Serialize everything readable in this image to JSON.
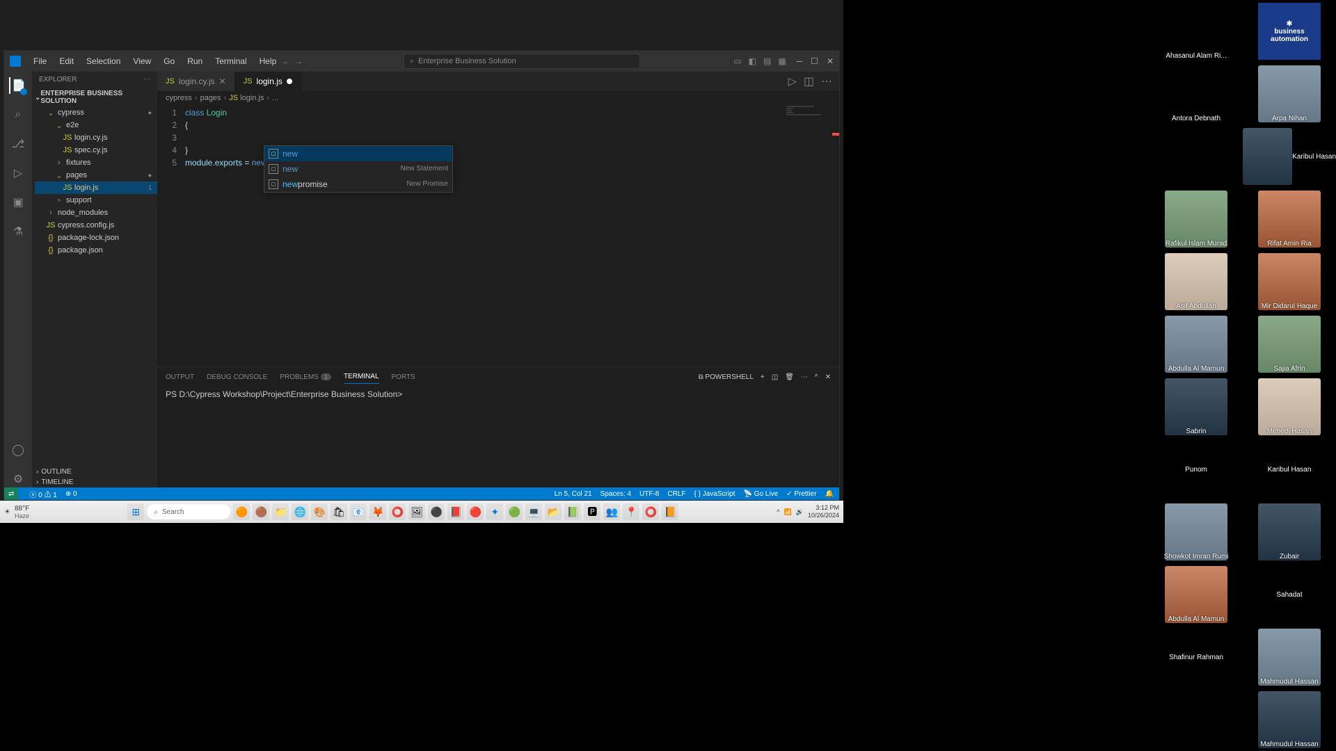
{
  "vscode": {
    "menu": [
      "File",
      "Edit",
      "Selection",
      "View",
      "Go",
      "Run",
      "Terminal",
      "Help"
    ],
    "searchPlaceholder": "Enterprise Business Solution",
    "tabs": [
      {
        "label": "login.cy.js",
        "active": false,
        "modified": false
      },
      {
        "label": "login.js",
        "active": true,
        "modified": true
      }
    ],
    "breadcrumb": [
      "cypress",
      "pages",
      "login.js",
      "..."
    ],
    "sidebar": {
      "header": "EXPLORER",
      "project": "ENTERPRISE BUSINESS SOLUTION",
      "tree": [
        {
          "label": "cypress",
          "kind": "folder",
          "ind": 1,
          "open": true,
          "badge": "●"
        },
        {
          "label": "e2e",
          "kind": "folder",
          "ind": 2,
          "open": true
        },
        {
          "label": "login.cy.js",
          "kind": "js",
          "ind": 3
        },
        {
          "label": "spec.cy.js",
          "kind": "js",
          "ind": 3
        },
        {
          "label": "fixtures",
          "kind": "folder",
          "ind": 2
        },
        {
          "label": "pages",
          "kind": "folder",
          "ind": 2,
          "open": true,
          "badge": "●"
        },
        {
          "label": "login.js",
          "kind": "js",
          "ind": 3,
          "selected": true,
          "active": true,
          "badge": "1"
        },
        {
          "label": "support",
          "kind": "folder",
          "ind": 2
        },
        {
          "label": "node_modules",
          "kind": "folder",
          "ind": 1
        },
        {
          "label": "cypress.config.js",
          "kind": "js",
          "ind": 1
        },
        {
          "label": "package-lock.json",
          "kind": "json",
          "ind": 1
        },
        {
          "label": "package.json",
          "kind": "json",
          "ind": 1
        }
      ],
      "outline": "OUTLINE",
      "timeline": "TIMELINE"
    },
    "code": {
      "lines": [
        "1",
        "2",
        "3",
        "4",
        "5"
      ],
      "l1a": "class ",
      "l1b": "Login",
      "l2": "{",
      "l4": "}",
      "l5a": "module",
      "l5b": ".exports",
      "l5c": " = ",
      "l5d": "new"
    },
    "suggest": [
      {
        "label": "new",
        "desc": "",
        "selected": true
      },
      {
        "label": "new",
        "desc": "New Statement",
        "selected": false
      },
      {
        "label": "newpromise",
        "match": "new",
        "rest": "promise",
        "desc": "New Promise",
        "selected": false
      }
    ],
    "panel": {
      "tabs": [
        "OUTPUT",
        "DEBUG CONSOLE",
        "PROBLEMS",
        "TERMINAL",
        "PORTS"
      ],
      "problemsBadge": "1",
      "activeTab": "TERMINAL",
      "shell": "powershell",
      "prompt": "PS D:\\Cypress Workshop\\Project\\Enterprise Business Solution>"
    },
    "status": {
      "errors": "0",
      "warnings": "1",
      "ports": "0",
      "cursor": "Ln 5, Col 21",
      "spaces": "Spaces: 4",
      "encoding": "UTF-8",
      "eol": "CRLF",
      "lang": "JavaScript",
      "golive": "Go Live",
      "prettier": "Prettier"
    }
  },
  "taskbar": {
    "weather_temp": "88°F",
    "weather_desc": "Haze",
    "search": "Search",
    "time": "3:12 PM",
    "date": "10/26/2024"
  },
  "participants": [
    [
      {
        "name": "Ahasanul Alam Ri...",
        "img": false
      },
      {
        "name": "business automation",
        "logo": true
      }
    ],
    [
      {
        "name": "Antora Debnath",
        "img": false
      },
      {
        "name": "Arpa Nihan",
        "img": true,
        "cls": "p1"
      }
    ],
    [
      {
        "name": "",
        "img": false
      },
      {
        "name": "Karibul Hasan",
        "img": true,
        "cls": "p2",
        "center": true
      }
    ],
    [
      {
        "name": "Rafikul Islam Murad",
        "img": true,
        "cls": "p4"
      },
      {
        "name": "Rifat Amin Ria",
        "img": true,
        "cls": "p3"
      }
    ],
    [
      {
        "name": "Asif Abdullah",
        "img": true,
        "cls": "p5"
      },
      {
        "name": "Mir Didarul Haque",
        "img": true,
        "cls": "p3"
      }
    ],
    [
      {
        "name": "Abdulla Al Mamun",
        "img": true,
        "cls": "p1"
      },
      {
        "name": "Sajia Afrin",
        "img": true,
        "cls": "p4"
      }
    ],
    [
      {
        "name": "Sabrin",
        "img": true,
        "cls": "p2"
      },
      {
        "name": "Mehedi Hasan",
        "img": true,
        "cls": "p5"
      }
    ],
    [
      {
        "name": "Punom",
        "img": false,
        "center": true
      },
      {
        "name": "Karibul  Hasan",
        "img": false,
        "center": true
      }
    ],
    [
      {
        "name": "Showkot Imran Rumi",
        "img": true,
        "cls": "p1"
      },
      {
        "name": "Zubair",
        "img": true,
        "cls": "p2"
      }
    ],
    [
      {
        "name": "Abdulla Al Mamun",
        "img": true,
        "cls": "p3"
      },
      {
        "name": "Sahadat",
        "img": false,
        "center": true
      }
    ],
    [
      {
        "name": "Shafinur Rahman",
        "img": false,
        "center": true
      },
      {
        "name": "Mahmudul Hassan",
        "img": true,
        "cls": "p1"
      }
    ],
    [
      {
        "name": "",
        "img": false
      },
      {
        "name": "Mahmudul Hassan",
        "img": true,
        "cls": "p2"
      }
    ]
  ]
}
